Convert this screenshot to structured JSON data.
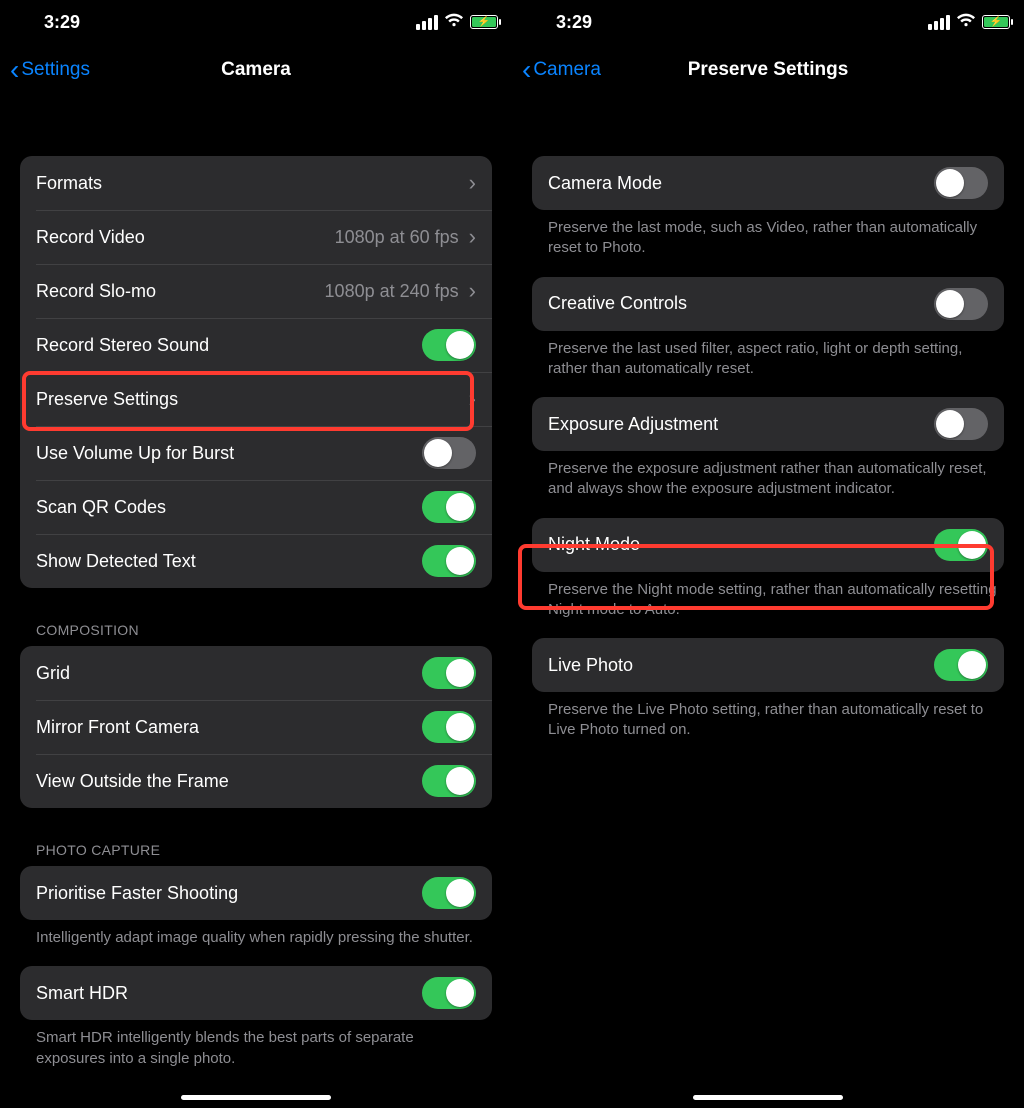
{
  "status": {
    "time": "3:29"
  },
  "left": {
    "back_label": "Settings",
    "title": "Camera",
    "rows": {
      "formats": "Formats",
      "record_video": "Record Video",
      "record_video_value": "1080p at 60 fps",
      "record_slomo": "Record Slo-mo",
      "record_slomo_value": "1080p at 240 fps",
      "record_stereo": "Record Stereo Sound",
      "preserve": "Preserve Settings",
      "volume_burst": "Use Volume Up for Burst",
      "scan_qr": "Scan QR Codes",
      "detected_text": "Show Detected Text"
    },
    "composition_header": "Composition",
    "composition": {
      "grid": "Grid",
      "mirror": "Mirror Front Camera",
      "outside": "View Outside the Frame"
    },
    "capture_header": "Photo Capture",
    "capture": {
      "prioritise": "Prioritise Faster Shooting",
      "prioritise_footer": "Intelligently adapt image quality when rapidly pressing the shutter.",
      "smart_hdr": "Smart HDR",
      "smart_hdr_footer": "Smart HDR intelligently blends the best parts of separate exposures into a single photo."
    },
    "toggles": {
      "record_stereo": true,
      "volume_burst": false,
      "scan_qr": true,
      "detected_text": true,
      "grid": true,
      "mirror": true,
      "outside": true,
      "prioritise": true,
      "smart_hdr": true
    }
  },
  "right": {
    "back_label": "Camera",
    "title": "Preserve Settings",
    "rows": {
      "camera_mode": "Camera Mode",
      "camera_mode_footer": "Preserve the last mode, such as Video, rather than automatically reset to Photo.",
      "creative": "Creative Controls",
      "creative_footer": "Preserve the last used filter, aspect ratio, light or depth setting, rather than automatically reset.",
      "exposure": "Exposure Adjustment",
      "exposure_footer": "Preserve the exposure adjustment rather than automatically reset, and always show the exposure adjustment indicator.",
      "night": "Night Mode",
      "night_footer": "Preserve the Night mode setting, rather than automatically resetting Night mode to Auto.",
      "live": "Live Photo",
      "live_footer": "Preserve the Live Photo setting, rather than automatically reset to Live Photo turned on."
    },
    "toggles": {
      "camera_mode": false,
      "creative": false,
      "exposure": false,
      "night": true,
      "live": true
    }
  }
}
